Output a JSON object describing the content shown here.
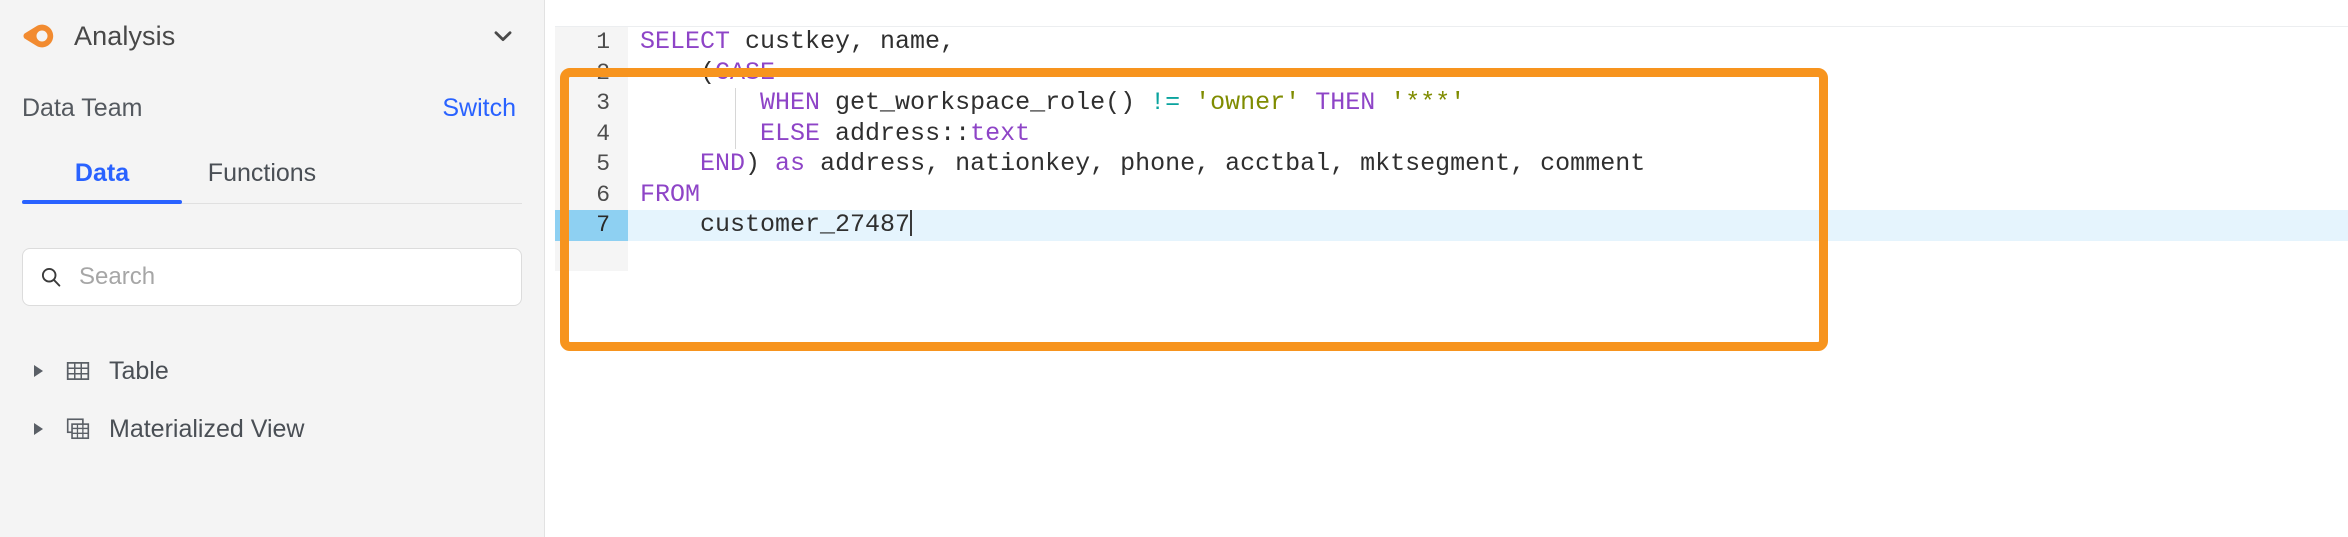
{
  "sidebar": {
    "brand": {
      "logo_icon": "eye-teardrop-logo-icon",
      "title": "Analysis",
      "collapse_icon": "chevron-down-icon"
    },
    "workspace": {
      "name": "Data Team",
      "switch_label": "Switch"
    },
    "tabs": [
      {
        "label": "Data",
        "active": true
      },
      {
        "label": "Functions",
        "active": false
      }
    ],
    "search": {
      "icon": "search-icon",
      "placeholder": "Search",
      "value": ""
    },
    "tree": [
      {
        "label": "Table",
        "icon": "table-grid-icon",
        "expanded": false
      },
      {
        "label": "Materialized View",
        "icon": "materialized-view-icon",
        "expanded": false
      }
    ]
  },
  "editor": {
    "active_line": 7,
    "cursor_line": 7,
    "lines": [
      {
        "n": "1",
        "tokens": [
          {
            "t": "SELECT",
            "c": "kw"
          },
          {
            "t": " custkey, name,",
            "c": ""
          }
        ]
      },
      {
        "n": "2",
        "tokens": [
          {
            "t": "    (",
            "c": ""
          },
          {
            "t": "CASE",
            "c": "kw"
          }
        ]
      },
      {
        "n": "3",
        "tokens": [
          {
            "t": "        ",
            "c": ""
          },
          {
            "t": "WHEN",
            "c": "kw"
          },
          {
            "t": " get_workspace_role() ",
            "c": ""
          },
          {
            "t": "!=",
            "c": "op"
          },
          {
            "t": " ",
            "c": ""
          },
          {
            "t": "'owner'",
            "c": "str"
          },
          {
            "t": " ",
            "c": ""
          },
          {
            "t": "THEN",
            "c": "kw"
          },
          {
            "t": " ",
            "c": ""
          },
          {
            "t": "'***'",
            "c": "str"
          }
        ]
      },
      {
        "n": "4",
        "tokens": [
          {
            "t": "        ",
            "c": ""
          },
          {
            "t": "ELSE",
            "c": "kw"
          },
          {
            "t": " address::",
            "c": ""
          },
          {
            "t": "text",
            "c": "typ"
          }
        ]
      },
      {
        "n": "5",
        "tokens": [
          {
            "t": "    ",
            "c": ""
          },
          {
            "t": "END",
            "c": "kw"
          },
          {
            "t": ") ",
            "c": ""
          },
          {
            "t": "as",
            "c": "kw"
          },
          {
            "t": " address, nationkey, phone, acctbal, mktsegment, comment",
            "c": ""
          }
        ]
      },
      {
        "n": "6",
        "tokens": [
          {
            "t": "FROM",
            "c": "kw"
          }
        ]
      },
      {
        "n": "7",
        "tokens": [
          {
            "t": "    customer_27487",
            "c": ""
          }
        ]
      }
    ],
    "full_query": "SELECT custkey, name,\n    (CASE\n        WHEN get_workspace_role() != 'owner' THEN '***'\n        ELSE address::text\n    END) as address, nationkey, phone, acctbal, mktsegment, comment\nFROM\n    customer_27487"
  },
  "annotation": {
    "highlight_color": "#f7941e",
    "shape": "rounded-rectangle"
  },
  "colors": {
    "accent_blue": "#2962ff",
    "brand_orange": "#f7941e",
    "keyword_purple": "#8e44c7",
    "string_olive": "#7f8c00",
    "operator_teal": "#0aa39e",
    "active_line_bg": "#e5f4fd",
    "active_gutter_bg": "#8ed0f2",
    "sidebar_bg": "#f4f4f4"
  }
}
